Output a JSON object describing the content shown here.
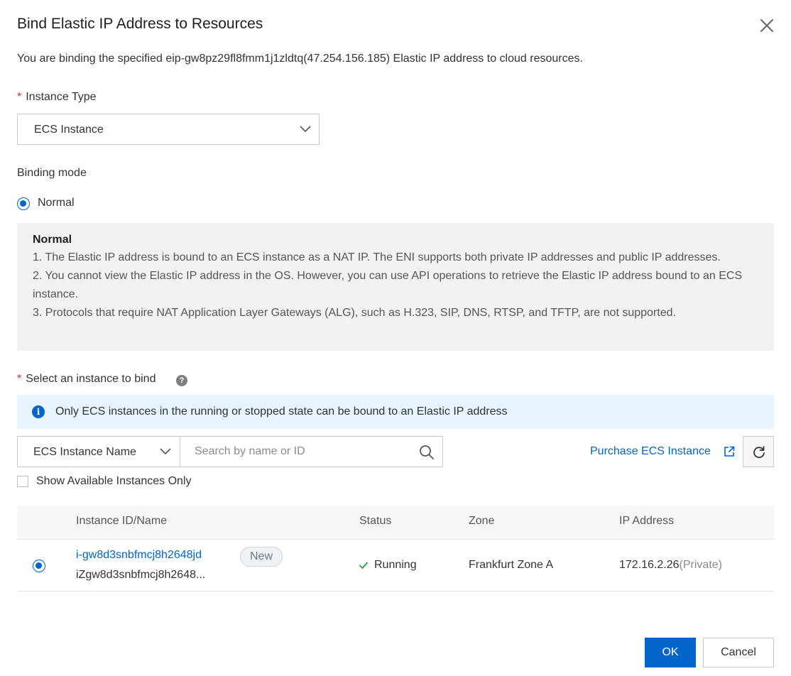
{
  "dialog": {
    "title": "Bind Elastic IP Address to Resources",
    "description": "You are binding the specified eip-gw8pz29fl8fmm1j1zldtq(47.254.156.185) Elastic IP address to cloud resources."
  },
  "instance_type": {
    "required_mark": "*",
    "label": "Instance Type",
    "value": "ECS Instance",
    "icon": "chevron-down-icon"
  },
  "binding_mode": {
    "label": "Binding mode",
    "selected_option": "Normal",
    "info": {
      "heading": "Normal",
      "lines": [
        "1. The Elastic IP address is bound to an ECS instance as a NAT IP. The ENI supports both private IP addresses and public IP addresses.",
        "2. You cannot view the Elastic IP address in the OS. However, you can use API operations to retrieve the Elastic IP address bound to an ECS instance.",
        "3. Protocols that require NAT Application Layer Gateways (ALG), such as H.323, SIP, DNS, RTSP, and TFTP, are not supported."
      ]
    }
  },
  "select_instance": {
    "required_mark": "*",
    "label": "Select an instance to bind",
    "help_icon": "?",
    "notice_icon": "i",
    "notice": "Only ECS instances in the running or stopped state can be bound to an Elastic IP address",
    "filter_field": "ECS Instance Name",
    "search_placeholder": "Search by name or ID",
    "purchase_link": "Purchase ECS Instance",
    "available_only_label": "Show Available Instances Only",
    "available_only_checked": false
  },
  "table": {
    "columns": [
      "Instance ID/Name",
      "Status",
      "Zone",
      "IP Address"
    ],
    "rows": [
      {
        "selected": true,
        "instance_id": "i-gw8d3snbfmcj8h2648jd",
        "instance_name": "iZgw8d3snbfmcj8h2648...",
        "badge": "New",
        "status": "Running",
        "zone": "Frankfurt Zone A",
        "ip": "172.16.2.26",
        "ip_type": "(Private)"
      }
    ]
  },
  "footer": {
    "ok_label": "OK",
    "cancel_label": "Cancel"
  },
  "colors": {
    "primary": "#0064c8",
    "required": "#d93026",
    "notice_bg": "#e8f4ff",
    "success": "#2e9e44"
  }
}
